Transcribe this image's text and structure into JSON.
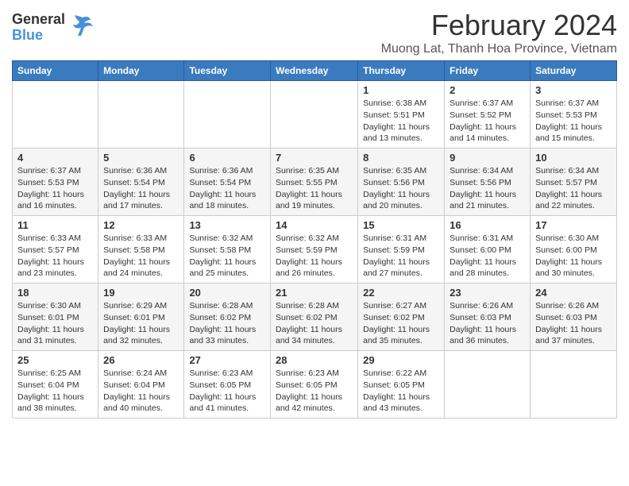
{
  "app": {
    "logo_general": "General",
    "logo_blue": "Blue",
    "month_title": "February 2024",
    "location": "Muong Lat, Thanh Hoa Province, Vietnam"
  },
  "calendar": {
    "headers": [
      "Sunday",
      "Monday",
      "Tuesday",
      "Wednesday",
      "Thursday",
      "Friday",
      "Saturday"
    ],
    "weeks": [
      [
        {
          "day": "",
          "info": ""
        },
        {
          "day": "",
          "info": ""
        },
        {
          "day": "",
          "info": ""
        },
        {
          "day": "",
          "info": ""
        },
        {
          "day": "1",
          "info": "Sunrise: 6:38 AM\nSunset: 5:51 PM\nDaylight: 11 hours\nand 13 minutes."
        },
        {
          "day": "2",
          "info": "Sunrise: 6:37 AM\nSunset: 5:52 PM\nDaylight: 11 hours\nand 14 minutes."
        },
        {
          "day": "3",
          "info": "Sunrise: 6:37 AM\nSunset: 5:53 PM\nDaylight: 11 hours\nand 15 minutes."
        }
      ],
      [
        {
          "day": "4",
          "info": "Sunrise: 6:37 AM\nSunset: 5:53 PM\nDaylight: 11 hours\nand 16 minutes."
        },
        {
          "day": "5",
          "info": "Sunrise: 6:36 AM\nSunset: 5:54 PM\nDaylight: 11 hours\nand 17 minutes."
        },
        {
          "day": "6",
          "info": "Sunrise: 6:36 AM\nSunset: 5:54 PM\nDaylight: 11 hours\nand 18 minutes."
        },
        {
          "day": "7",
          "info": "Sunrise: 6:35 AM\nSunset: 5:55 PM\nDaylight: 11 hours\nand 19 minutes."
        },
        {
          "day": "8",
          "info": "Sunrise: 6:35 AM\nSunset: 5:56 PM\nDaylight: 11 hours\nand 20 minutes."
        },
        {
          "day": "9",
          "info": "Sunrise: 6:34 AM\nSunset: 5:56 PM\nDaylight: 11 hours\nand 21 minutes."
        },
        {
          "day": "10",
          "info": "Sunrise: 6:34 AM\nSunset: 5:57 PM\nDaylight: 11 hours\nand 22 minutes."
        }
      ],
      [
        {
          "day": "11",
          "info": "Sunrise: 6:33 AM\nSunset: 5:57 PM\nDaylight: 11 hours\nand 23 minutes."
        },
        {
          "day": "12",
          "info": "Sunrise: 6:33 AM\nSunset: 5:58 PM\nDaylight: 11 hours\nand 24 minutes."
        },
        {
          "day": "13",
          "info": "Sunrise: 6:32 AM\nSunset: 5:58 PM\nDaylight: 11 hours\nand 25 minutes."
        },
        {
          "day": "14",
          "info": "Sunrise: 6:32 AM\nSunset: 5:59 PM\nDaylight: 11 hours\nand 26 minutes."
        },
        {
          "day": "15",
          "info": "Sunrise: 6:31 AM\nSunset: 5:59 PM\nDaylight: 11 hours\nand 27 minutes."
        },
        {
          "day": "16",
          "info": "Sunrise: 6:31 AM\nSunset: 6:00 PM\nDaylight: 11 hours\nand 28 minutes."
        },
        {
          "day": "17",
          "info": "Sunrise: 6:30 AM\nSunset: 6:00 PM\nDaylight: 11 hours\nand 30 minutes."
        }
      ],
      [
        {
          "day": "18",
          "info": "Sunrise: 6:30 AM\nSunset: 6:01 PM\nDaylight: 11 hours\nand 31 minutes."
        },
        {
          "day": "19",
          "info": "Sunrise: 6:29 AM\nSunset: 6:01 PM\nDaylight: 11 hours\nand 32 minutes."
        },
        {
          "day": "20",
          "info": "Sunrise: 6:28 AM\nSunset: 6:02 PM\nDaylight: 11 hours\nand 33 minutes."
        },
        {
          "day": "21",
          "info": "Sunrise: 6:28 AM\nSunset: 6:02 PM\nDaylight: 11 hours\nand 34 minutes."
        },
        {
          "day": "22",
          "info": "Sunrise: 6:27 AM\nSunset: 6:02 PM\nDaylight: 11 hours\nand 35 minutes."
        },
        {
          "day": "23",
          "info": "Sunrise: 6:26 AM\nSunset: 6:03 PM\nDaylight: 11 hours\nand 36 minutes."
        },
        {
          "day": "24",
          "info": "Sunrise: 6:26 AM\nSunset: 6:03 PM\nDaylight: 11 hours\nand 37 minutes."
        }
      ],
      [
        {
          "day": "25",
          "info": "Sunrise: 6:25 AM\nSunset: 6:04 PM\nDaylight: 11 hours\nand 38 minutes."
        },
        {
          "day": "26",
          "info": "Sunrise: 6:24 AM\nSunset: 6:04 PM\nDaylight: 11 hours\nand 40 minutes."
        },
        {
          "day": "27",
          "info": "Sunrise: 6:23 AM\nSunset: 6:05 PM\nDaylight: 11 hours\nand 41 minutes."
        },
        {
          "day": "28",
          "info": "Sunrise: 6:23 AM\nSunset: 6:05 PM\nDaylight: 11 hours\nand 42 minutes."
        },
        {
          "day": "29",
          "info": "Sunrise: 6:22 AM\nSunset: 6:05 PM\nDaylight: 11 hours\nand 43 minutes."
        },
        {
          "day": "",
          "info": ""
        },
        {
          "day": "",
          "info": ""
        }
      ]
    ]
  }
}
